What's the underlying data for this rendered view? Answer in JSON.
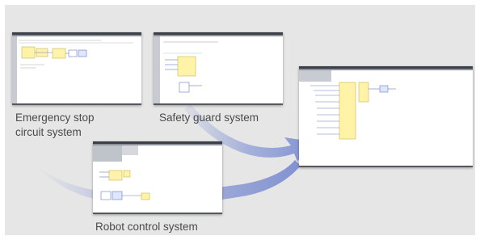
{
  "captions": {
    "emergency_line1": "Emergency stop",
    "emergency_line2": "circuit system",
    "safety_guard": "Safety guard system",
    "robot_control": "Robot control system"
  },
  "colors": {
    "background": "#e6e6e6",
    "arrow": "#8a9ad6",
    "block_fill": "#fff3a8",
    "block_stroke": "#c9b64a",
    "window_titlebar": "#3b3f48"
  }
}
